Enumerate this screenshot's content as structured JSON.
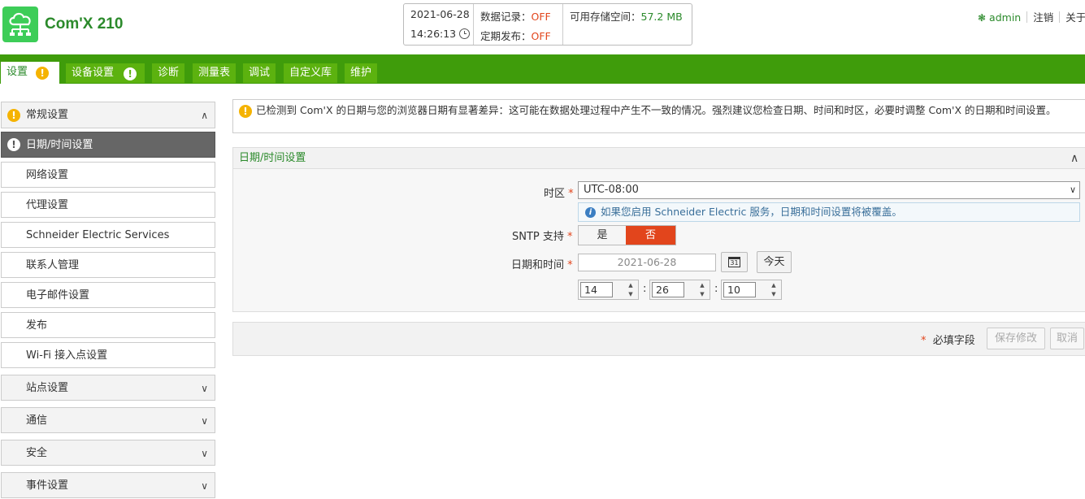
{
  "header": {
    "brand": "Com'X 210",
    "status": {
      "date": "2021-06-28",
      "time": "14:26:13",
      "data_logging_label": "数据记录：",
      "data_logging_value": "OFF",
      "scheduled_publish_label": "定期发布：",
      "scheduled_publish_value": "OFF",
      "storage_label": "可用存储空间：",
      "storage_value": "57.2 MB"
    },
    "user": "admin",
    "logout": "注销",
    "about": "关于"
  },
  "nav": {
    "tabs": [
      {
        "label": "设置",
        "active": true,
        "warning": true
      },
      {
        "label": "设备设置",
        "warning": true
      },
      {
        "label": "诊断"
      },
      {
        "label": "测量表"
      },
      {
        "label": "调试"
      },
      {
        "label": "自定义库"
      },
      {
        "label": "维护"
      }
    ]
  },
  "sidebar": {
    "items": [
      {
        "label": "常规设置",
        "type": "header",
        "expanded": true
      },
      {
        "label": "日期/时间设置",
        "active": true
      },
      {
        "label": "网络设置"
      },
      {
        "label": "代理设置"
      },
      {
        "label": "Schneider Electric Services"
      },
      {
        "label": "联系人管理"
      },
      {
        "label": "电子邮件设置"
      },
      {
        "label": "发布"
      },
      {
        "label": "Wi-Fi 接入点设置"
      },
      {
        "label": "站点设置",
        "type": "header"
      },
      {
        "label": "通信",
        "type": "header"
      },
      {
        "label": "安全",
        "type": "header"
      },
      {
        "label": "事件设置",
        "type": "header"
      }
    ]
  },
  "alert": {
    "text": "已检测到 Com'X 的日期与您的浏览器日期有显著差异：这可能在数据处理过程中产生不一致的情况。强烈建议您检查日期、时间和时区，必要时调整 Com'X 的日期和时间设置。"
  },
  "panel": {
    "title": "日期/时间设置",
    "timezone_label": "时区",
    "timezone_value": "UTC-08:00",
    "info_text": "如果您启用 Schneider Electric 服务，日期和时间设置将被覆盖。",
    "sntp_label": "SNTP 支持",
    "sntp_yes": "是",
    "sntp_no": "否",
    "sntp_selected": "否",
    "datetime_label": "日期和时间",
    "date_value": "2021-06-28",
    "today_button": "今天",
    "calendar_day": "31",
    "hour": "14",
    "minute": "26",
    "second": "10"
  },
  "footer": {
    "required_note": "必填字段",
    "save": "保存修改",
    "cancel": "取消"
  },
  "colors": {
    "brand_green": "#3dcd58",
    "nav_green": "#3f9c0b",
    "tab_green": "#5cb20f",
    "off_red": "#e2451c",
    "warning_yellow": "#f5b301"
  }
}
